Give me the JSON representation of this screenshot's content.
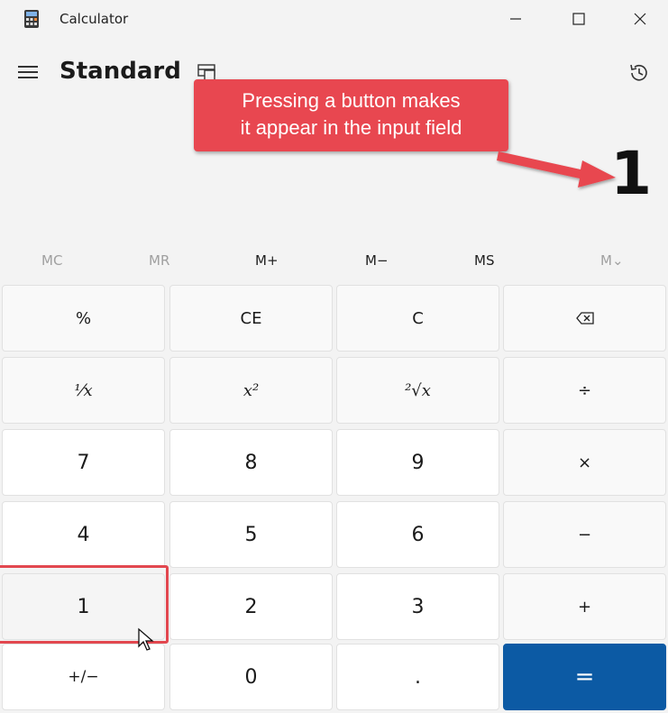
{
  "window": {
    "title": "Calculator",
    "controls": {
      "minimize": "—",
      "maximize": "☐",
      "close": "✕"
    }
  },
  "header": {
    "mode": "Standard"
  },
  "display": {
    "value": "1"
  },
  "annotation": {
    "line1": "Pressing a button makes",
    "line2": "it appear in the input field",
    "color": "#e84750"
  },
  "memory": [
    "MC",
    "MR",
    "M+",
    "M−",
    "MS",
    "M⌄"
  ],
  "keys": {
    "percent": "%",
    "ce": "CE",
    "c": "C",
    "backspace": "⌫",
    "reciprocal": "⅟x",
    "square": "x²",
    "sqrt": "²√x",
    "divide": "÷",
    "seven": "7",
    "eight": "8",
    "nine": "9",
    "multiply": "×",
    "four": "4",
    "five": "5",
    "six": "6",
    "minus": "−",
    "one": "1",
    "two": "2",
    "three": "3",
    "plus": "+",
    "negate": "+/−",
    "zero": "0",
    "decimal": ".",
    "equals": "="
  },
  "colors": {
    "accent": "#0c5aa4",
    "background": "#f3f3f3",
    "highlight": "#e2474f"
  }
}
